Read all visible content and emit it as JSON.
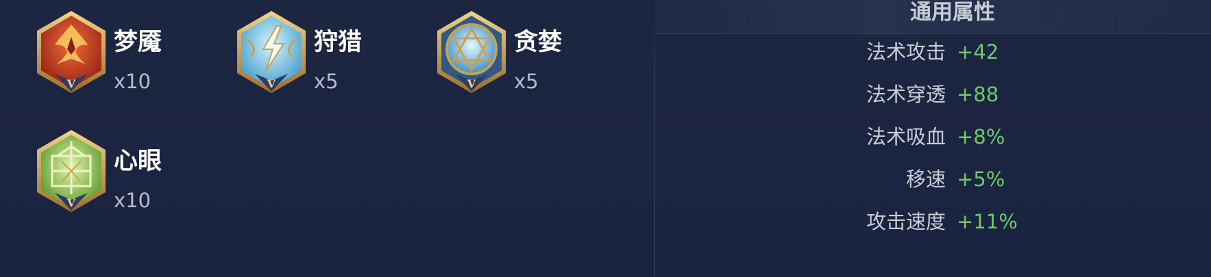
{
  "runes": [
    {
      "name": "梦魇",
      "count": "x10",
      "icon": "nightmare-rune-icon",
      "color": "#c9432a",
      "level": "V"
    },
    {
      "name": "狩猎",
      "count": "x5",
      "icon": "hunt-rune-icon",
      "color": "#8fd0e8",
      "level": "V"
    },
    {
      "name": "贪婪",
      "count": "x5",
      "icon": "greed-rune-icon",
      "color": "#7cc7e3",
      "level": "V"
    },
    {
      "name": "心眼",
      "count": "x10",
      "icon": "mind-eye-rune-icon",
      "color": "#7dbb43",
      "level": "V"
    }
  ],
  "attributes": {
    "title": "通用属性",
    "rows": [
      {
        "label": "法术攻击",
        "value": "+42"
      },
      {
        "label": "法术穿透",
        "value": "+88"
      },
      {
        "label": "法术吸血",
        "value": "+8%"
      },
      {
        "label": "移速",
        "value": "+5%"
      },
      {
        "label": "攻击速度",
        "value": "+11%"
      }
    ]
  },
  "colors": {
    "background": "#1c2540",
    "value_green": "#6fc96a",
    "gold_frame": "#c9a24f"
  }
}
